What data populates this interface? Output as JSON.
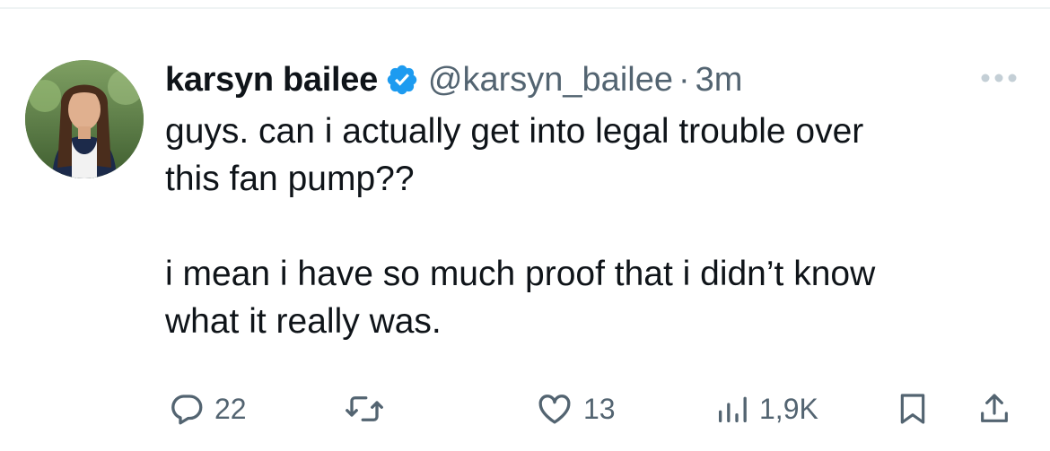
{
  "tweet": {
    "author": {
      "display_name": "karsyn bailee",
      "handle": "@karsyn_bailee",
      "verified": true
    },
    "separator": "·",
    "timestamp": "3m",
    "text": "guys. can i actually get into legal trouble over\nthis fan pump??\n\ni mean i have so much proof that i didn’t know\nwhat it really was.",
    "metrics": {
      "replies": "22",
      "likes": "13",
      "views": "1,9K"
    }
  },
  "icons": {
    "verified": "verified-badge-icon",
    "more": "more-horizontal-icon",
    "reply": "reply-icon",
    "retweet": "retweet-icon",
    "like": "heart-icon",
    "views": "views-chart-icon",
    "bookmark": "bookmark-icon",
    "share": "share-icon"
  },
  "colors": {
    "text_primary": "#0f1419",
    "text_secondary": "#536471",
    "verified_blue": "#1d9bf0"
  }
}
